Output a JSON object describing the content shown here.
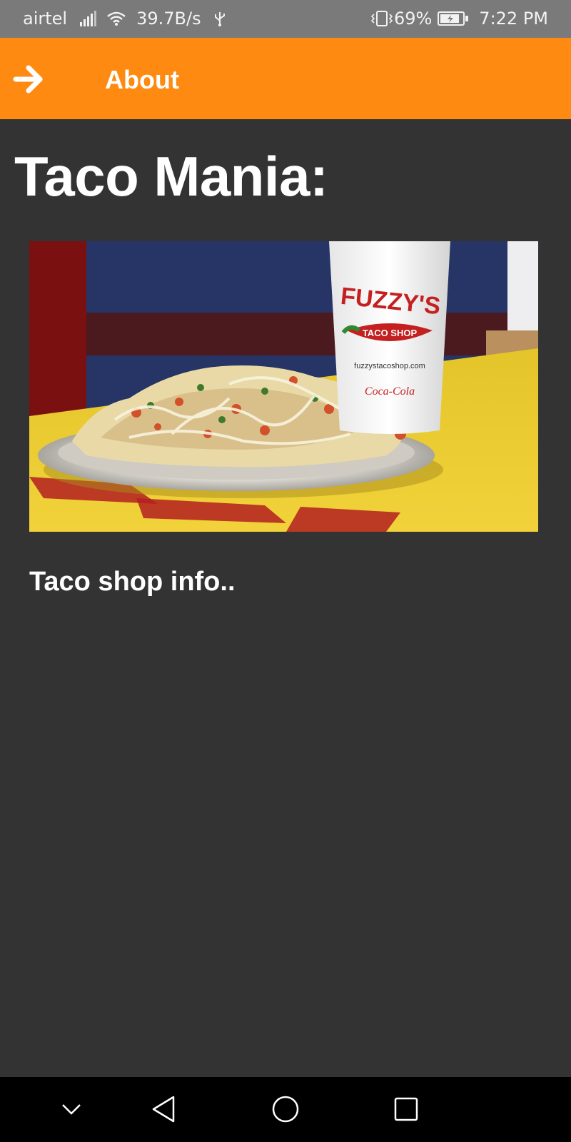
{
  "status_bar": {
    "carrier": "airtel",
    "network_speed": "39.7B/s",
    "battery_percent": "69%",
    "time": "7:22 PM",
    "icons": [
      "signal-icon",
      "wifi-icon",
      "usb-icon",
      "vibrate-icon",
      "battery-charging-icon"
    ]
  },
  "app_bar": {
    "title": "About",
    "nav_icon": "arrow-right-icon",
    "background_color": "#ff8a12"
  },
  "content": {
    "heading": "Taco Mania:",
    "photo": {
      "subject": "nachos plate with Fuzzy's Taco Shop cup",
      "cup_brand": "FUZZY'S",
      "cup_sub": "TACO SHOP",
      "cup_url": "fuzzystacoshop.com",
      "cup_sponsor": "Coca-Cola"
    },
    "info_text": "Taco shop info.."
  },
  "nav_bar": {
    "buttons": [
      "chevron-down-icon",
      "back-triangle-icon",
      "home-circle-icon",
      "recents-square-icon"
    ]
  },
  "colors": {
    "background": "#333333",
    "accent": "#ff8a12",
    "text": "#ffffff"
  }
}
